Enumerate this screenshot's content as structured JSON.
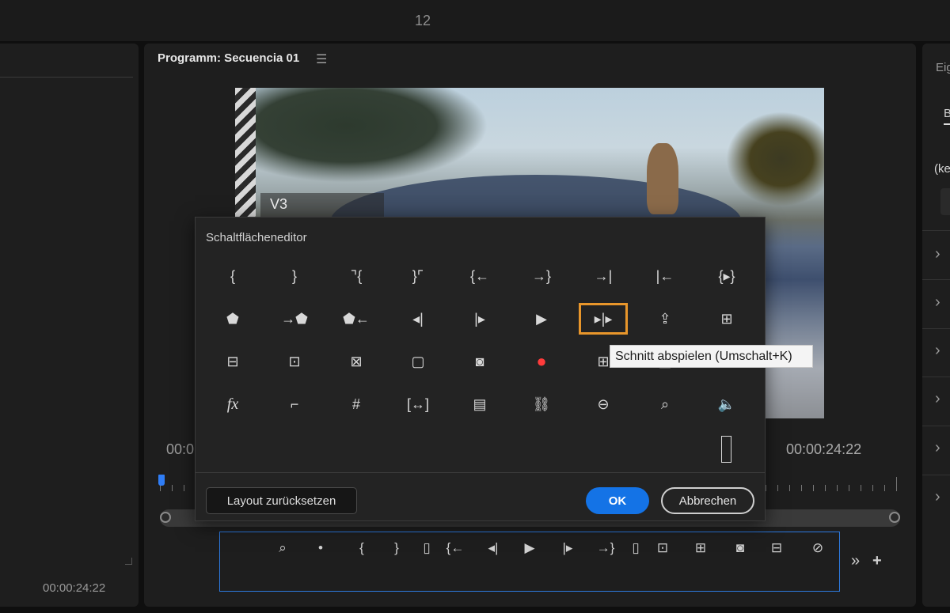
{
  "topbar": {
    "number": "12"
  },
  "left_panel": {
    "timecode": "00:00:24:22"
  },
  "program_monitor": {
    "title": "Programm: Secuencia 01",
    "menu_icon": "hamburger-menu-icon",
    "track_label": "V3",
    "timecode_left": "00:0",
    "timecode_right": "00:00:24:22",
    "button_bar_icons": [
      "marker-search-icon",
      "marker-icon",
      "mark-in-icon",
      "mark-out-icon",
      "sliver-icon",
      "go-to-in-icon",
      "step-back-icon",
      "play-icon",
      "step-forward-icon",
      "go-to-out-icon",
      "sliver-icon",
      "lift-icon",
      "extract-icon",
      "export-frame-icon",
      "comparison-view-icon",
      "proxy-toggle-icon"
    ],
    "button_bar_more": "»",
    "button_bar_add": "+"
  },
  "right_panel": {
    "label": "Eig",
    "tab": "B",
    "label2": "(ke"
  },
  "dialog": {
    "title": "Schaltflächeneditor",
    "icons": [
      [
        "mark-in-icon",
        "mark-out-icon",
        "clear-in-icon",
        "clear-out-icon",
        "go-to-in-icon",
        "go-to-out-icon",
        "go-to-next-edit-icon",
        "go-to-prev-edit-icon",
        "mark-clip-icon"
      ],
      [
        "add-marker-icon",
        "go-to-next-marker-icon",
        "go-to-prev-marker-icon",
        "step-back-icon",
        "step-forward-icon",
        "play-icon",
        "play-around-icon",
        "export-icon",
        "extract-icon"
      ],
      [
        "insert-icon",
        "lift-icon",
        "overwrite-icon",
        "safe-margins-icon",
        "export-frame-icon",
        "record-icon",
        "multi-camera-icon",
        "comparison-icon",
        "settings-icon"
      ],
      [
        "fx-icon",
        "trim-icon",
        "grid-icon",
        "rulers-icon",
        "proxy-icon",
        "link-icon",
        "vr-video-icon",
        "marker-search-icon",
        "volume-icon"
      ]
    ],
    "reset_label": "Layout zurücksetzen",
    "ok_label": "OK",
    "cancel_label": "Abbrechen",
    "tooltip": "Schnitt abspielen (Umschalt+K)",
    "accent_color": "#e8962b",
    "primary_color": "#1473e6"
  }
}
